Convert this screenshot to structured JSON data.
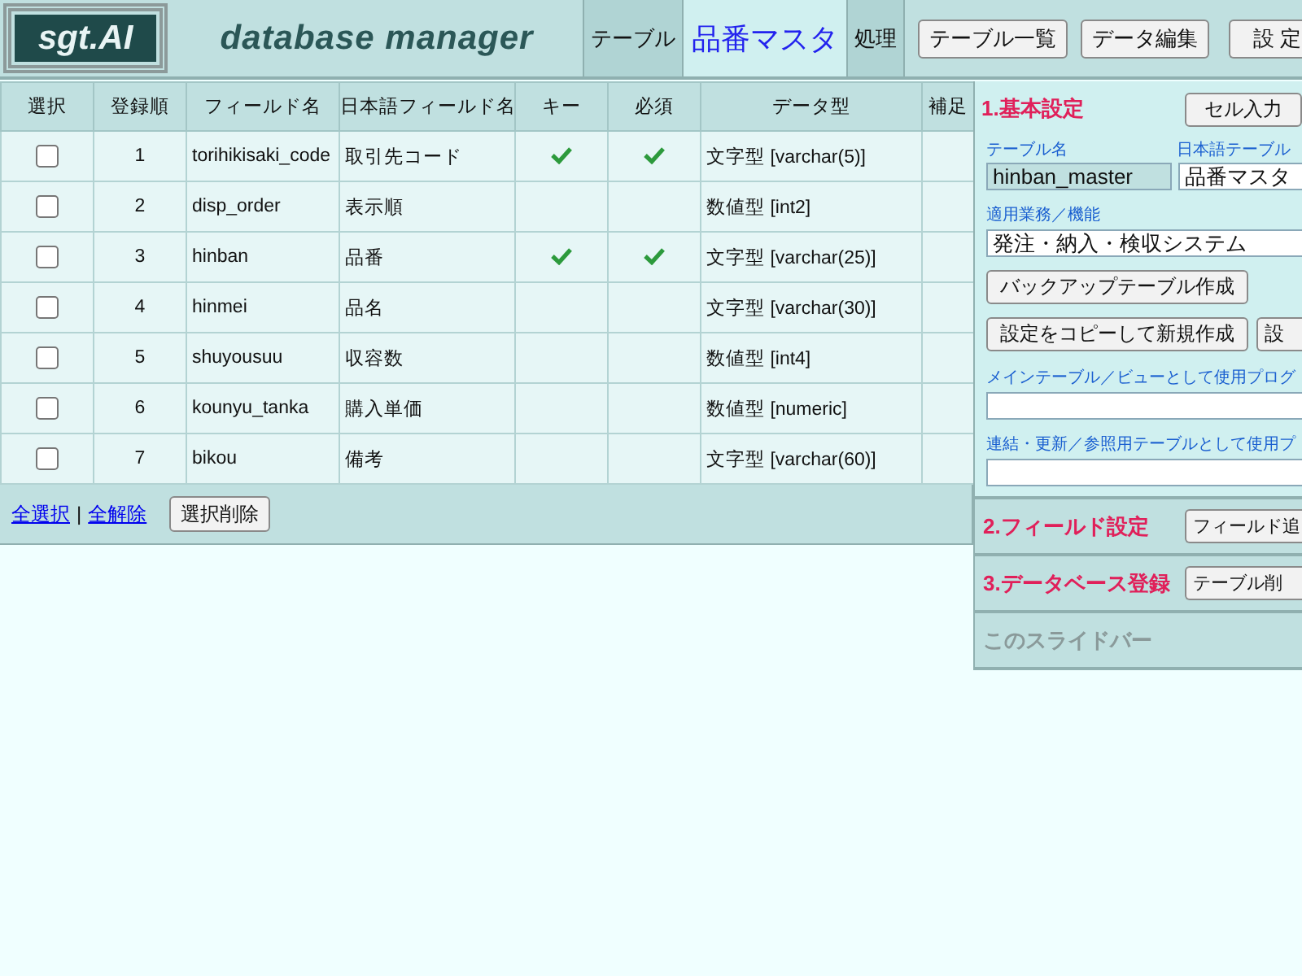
{
  "header": {
    "logo": "sgt.AI",
    "title": "database manager",
    "tabs": [
      {
        "label": "テーブル",
        "selected": false
      },
      {
        "label": "品番マスタ",
        "selected": true
      },
      {
        "label": "処理",
        "selected": false
      }
    ],
    "buttons": [
      "テーブル一覧",
      "データ編集",
      "設 定"
    ]
  },
  "table": {
    "columns": [
      "選択",
      "登録順",
      "フィールド名",
      "日本語フィールド名",
      "キー",
      "必須",
      "データ型",
      "補足"
    ],
    "rows": [
      {
        "checked": false,
        "order": "1",
        "field_name": "torihikisaki_code",
        "japanese_name": "取引先コード",
        "key": true,
        "required": true,
        "data_type": "文字型 [varchar(5)]"
      },
      {
        "checked": false,
        "order": "2",
        "field_name": "disp_order",
        "japanese_name": "表示順",
        "key": false,
        "required": false,
        "data_type": "数値型 [int2]"
      },
      {
        "checked": false,
        "order": "3",
        "field_name": "hinban",
        "japanese_name": "品番",
        "key": true,
        "required": true,
        "data_type": "文字型 [varchar(25)]"
      },
      {
        "checked": false,
        "order": "4",
        "field_name": "hinmei",
        "japanese_name": "品名",
        "key": false,
        "required": false,
        "data_type": "文字型 [varchar(30)]"
      },
      {
        "checked": false,
        "order": "5",
        "field_name": "shuyousuu",
        "japanese_name": "収容数",
        "key": false,
        "required": false,
        "data_type": "数値型 [int4]"
      },
      {
        "checked": false,
        "order": "6",
        "field_name": "kounyu_tanka",
        "japanese_name": "購入単価",
        "key": false,
        "required": false,
        "data_type": "数値型 [numeric]"
      },
      {
        "checked": false,
        "order": "7",
        "field_name": "bikou",
        "japanese_name": "備考",
        "key": false,
        "required": false,
        "data_type": "文字型 [varchar(60)]"
      }
    ]
  },
  "table_footer": {
    "links": [
      "全選択",
      "全解除"
    ],
    "separator": "|",
    "button": "選択削除"
  },
  "settings_panel": {
    "basic": {
      "heading": "1.基本設定",
      "button": "セル入力",
      "table_name": {
        "label": "テーブル名",
        "value": "hinban_master",
        "readonly": true
      },
      "japanese_table_name": {
        "label": "日本語テーブル",
        "value": "品番マスタ",
        "readonly": false
      },
      "application": {
        "label": "適用業務／機能",
        "value": "発注・納入・検収システム",
        "readonly": false
      },
      "buttons": [
        "バックアップテーブル作成",
        "設定をコピーして新規作成",
        "設"
      ],
      "main_table_programs": {
        "label": "メインテーブル／ビューとして使用プログ"
      },
      "linked_table_programs": {
        "label": "連結・更新／参照用テーブルとして使用プ"
      }
    },
    "sections": [
      {
        "kind": "action",
        "heading": "2.フィールド設定",
        "button": "フィールド追"
      },
      {
        "kind": "action",
        "heading": "3.データベース登録",
        "button": "テーブル削"
      },
      {
        "kind": "note",
        "heading": "このスライドバー"
      }
    ]
  }
}
